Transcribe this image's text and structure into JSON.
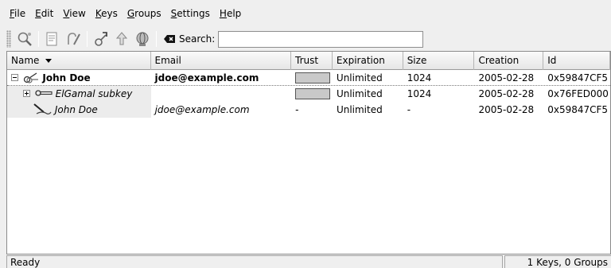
{
  "menu": [
    {
      "key": "F",
      "rest": "ile"
    },
    {
      "key": "E",
      "rest": "dit"
    },
    {
      "key": "V",
      "rest": "iew"
    },
    {
      "key": "K",
      "rest": "eys"
    },
    {
      "key": "G",
      "rest": "roups"
    },
    {
      "key": "S",
      "rest": "ettings"
    },
    {
      "key": "H",
      "rest": "elp"
    }
  ],
  "toolbar": {
    "search_label": "Search:",
    "search_value": ""
  },
  "columns": [
    "Name",
    "Email",
    "Trust",
    "Expiration",
    "Size",
    "Creation",
    "Id"
  ],
  "rows": [
    {
      "name": "John Doe",
      "email": "jdoe@example.com",
      "trust": "",
      "expiration": "Unlimited",
      "size": "1024",
      "creation": "2005-02-28",
      "id": "0x59847CF5"
    },
    {
      "name": "ElGamal subkey",
      "email": "",
      "trust": "",
      "expiration": "Unlimited",
      "size": "1024",
      "creation": "2005-02-28",
      "id": "0x76FED000"
    },
    {
      "name": "John Doe",
      "email": "jdoe@example.com",
      "trust": "-",
      "expiration": "Unlimited",
      "size": "-",
      "creation": "2005-02-28",
      "id": "0x59847CF5"
    }
  ],
  "status": {
    "left": "Ready",
    "right": "1 Keys, 0 Groups"
  },
  "colors": {
    "trust_fill": "#c9c9c9",
    "window_bg": "#efefef"
  }
}
